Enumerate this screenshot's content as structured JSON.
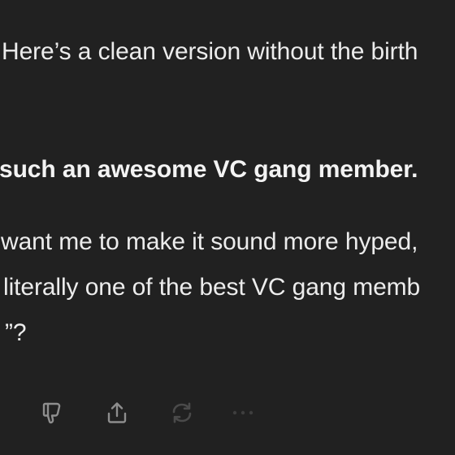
{
  "message": {
    "intro": "Here’s a clean version without the birth",
    "bold_line": "such an awesome VC gang member.",
    "question_lines": [
      "want me to make it sound more hyped,",
      "literally one of the best VC gang memb",
      "”?"
    ]
  },
  "actions": [
    {
      "icon": "thumbs-down-icon"
    },
    {
      "icon": "share-icon"
    },
    {
      "icon": "regenerate-icon"
    },
    {
      "icon": "more-options-icon"
    }
  ],
  "colors": {
    "background": "#212121",
    "text": "#ececec",
    "icon": "#8e8e8e",
    "icon_dim": "#4a4a4a"
  }
}
